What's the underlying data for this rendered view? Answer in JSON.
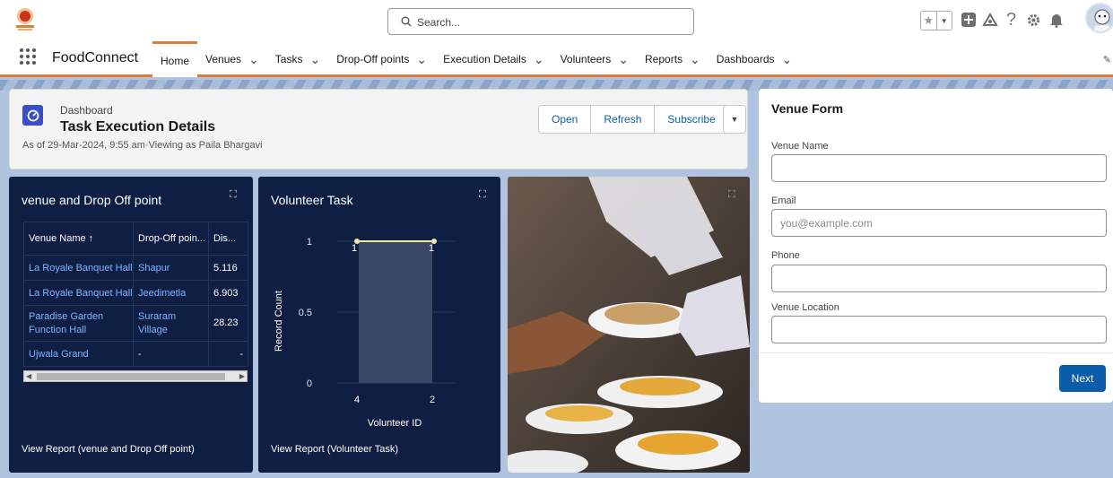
{
  "header": {
    "search_placeholder": "Search...",
    "app_name": "FoodConnect",
    "nav": [
      {
        "label": "Home",
        "chevron": false
      },
      {
        "label": "Venues",
        "chevron": true
      },
      {
        "label": "Tasks",
        "chevron": true
      },
      {
        "label": "Drop-Off points",
        "chevron": true
      },
      {
        "label": "Execution Details",
        "chevron": true
      },
      {
        "label": "Volunteers",
        "chevron": true
      },
      {
        "label": "Reports",
        "chevron": true
      },
      {
        "label": "Dashboards",
        "chevron": true
      }
    ]
  },
  "dashboard": {
    "kicker": "Dashboard",
    "title": "Task Execution Details",
    "subtitle": "As of 29-Mar-2024, 9:55 am·Viewing as Paila Bhargavi",
    "buttons": {
      "open": "Open",
      "refresh": "Refresh",
      "subscribe": "Subscribe"
    }
  },
  "widget_table": {
    "title": "venue and Drop Off point",
    "columns": [
      "Venue Name ↑",
      "Drop-Off poin...",
      "Dis..."
    ],
    "rows": [
      [
        "La Royale Banquet Hall.",
        "Shapur",
        "5.116"
      ],
      [
        "La Royale Banquet Hall.",
        "Jeedimetla",
        "6.903"
      ],
      [
        "Paradise Garden Function Hall",
        "Suraram Village",
        "28.23"
      ],
      [
        "Ujwala Grand",
        "-",
        "-"
      ]
    ],
    "footer": "View Report (venue and Drop Off point)"
  },
  "widget_chart": {
    "title": "Volunteer Task",
    "footer": "View Report (Volunteer Task)"
  },
  "chart_data": {
    "type": "bar",
    "categories": [
      "4",
      "2"
    ],
    "values": [
      1,
      1
    ],
    "data_labels": [
      "1",
      "1"
    ],
    "line_values": [
      1,
      1
    ],
    "xlabel": "Volunteer ID",
    "ylabel": "Record Count",
    "yticks": [
      "0",
      "0.5",
      "1"
    ],
    "ylim": [
      0,
      1
    ],
    "colors": {
      "bar": "#3a4763",
      "line": "#f3e7a7"
    }
  },
  "form": {
    "title": "Venue Form",
    "fields": [
      {
        "label": "Venue Name",
        "value": ""
      },
      {
        "label": "Email",
        "placeholder": "you@example.com"
      },
      {
        "label": "Phone",
        "value": ""
      },
      {
        "label": "Venue Location",
        "value": ""
      }
    ],
    "next": "Next"
  },
  "colors": {
    "accent": "#0b5cab",
    "nav_underline": "#e07b39",
    "widget_bg": "#0f1f44"
  }
}
